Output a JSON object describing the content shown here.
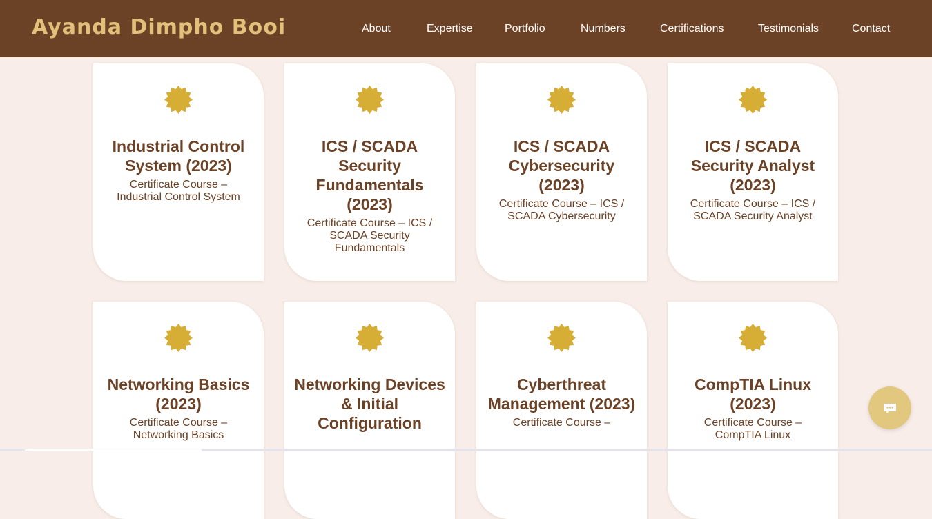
{
  "brand": "Ayanda Dimpho Booi",
  "nav": [
    "About",
    "Expertise",
    "Portfolio",
    "Numbers",
    "Certifications",
    "Testimonials",
    "Contact"
  ],
  "colors": {
    "header": "#6b4226",
    "brand_text": "#e2c07a",
    "background": "#f8ede8",
    "badge": "#d6ad35",
    "text": "#6b4226",
    "chat_button": "#e2c77f"
  },
  "certifications": [
    {
      "title": "Industrial Control System (2023)",
      "desc": "Certificate Course – Industrial Control System",
      "icon": "award-badge-icon"
    },
    {
      "title": "ICS / SCADA Security Fundamentals (2023)",
      "desc": "Certificate Course – ICS / SCADA Security Fundamentals",
      "icon": "award-badge-icon"
    },
    {
      "title": "ICS / SCADA Cybersecurity (2023)",
      "desc": "Certificate Course – ICS / SCADA Cybersecurity",
      "icon": "award-badge-icon"
    },
    {
      "title": "ICS / SCADA Security Analyst (2023)",
      "desc": "Certificate Course – ICS / SCADA Security Analyst",
      "icon": "award-badge-icon"
    },
    {
      "title": "Networking Basics (2023)",
      "desc": "Certificate Course – Networking Basics",
      "icon": "award-badge-icon"
    },
    {
      "title": "Networking Devices & Initial Configuration",
      "desc": "",
      "icon": "award-badge-icon"
    },
    {
      "title": "Cyberthreat Management (2023)",
      "desc": "Certificate Course –",
      "icon": "award-badge-icon"
    },
    {
      "title": "CompTIA Linux (2023)",
      "desc": "Certificate Course – CompTIA Linux",
      "icon": "award-badge-icon"
    }
  ],
  "chat": {
    "icon": "chat-icon"
  }
}
